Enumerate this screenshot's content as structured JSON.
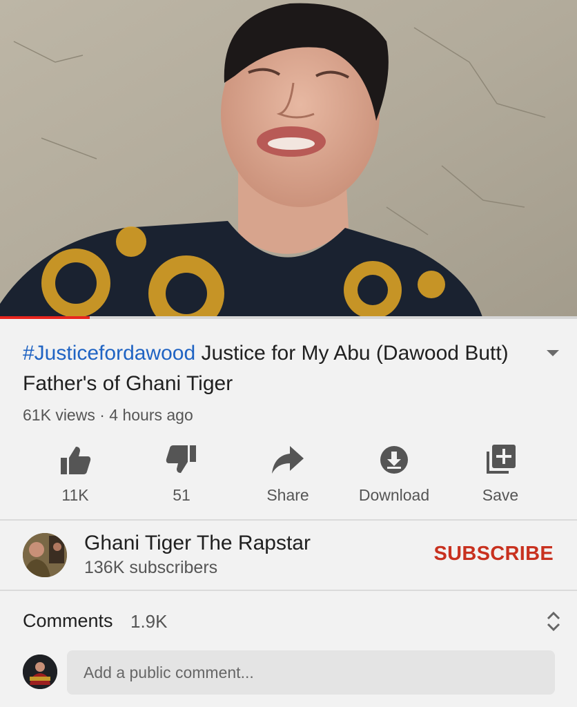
{
  "video": {
    "progress_fraction": 0.155,
    "hashtag": "#Justicefordawood",
    "title_rest": " Justice for My Abu (Dawood Butt) Father's of Ghani Tiger",
    "views": "61K views",
    "separator": " · ",
    "age": "4 hours ago"
  },
  "actions": {
    "like_label": "11K",
    "dislike_label": "51",
    "share_label": "Share",
    "download_label": "Download",
    "save_label": "Save"
  },
  "channel": {
    "name": "Ghani Tiger The Rapstar",
    "subscribers": "136K subscribers",
    "subscribe_label": "SUBSCRIBE"
  },
  "comments": {
    "title": "Comments",
    "count": "1.9K",
    "placeholder": "Add a public comment..."
  },
  "icons": {
    "like": "thumbs-up-icon",
    "dislike": "thumbs-down-icon",
    "share": "share-arrow-icon",
    "download": "download-circle-icon",
    "save": "playlist-add-icon",
    "expand": "chevron-down-icon",
    "sort": "sort-arrows-icon"
  },
  "colors": {
    "hashtag": "#1f63c3",
    "subscribe": "#c8311f",
    "progress": "#e8261e",
    "background": "#f2f2f2"
  }
}
